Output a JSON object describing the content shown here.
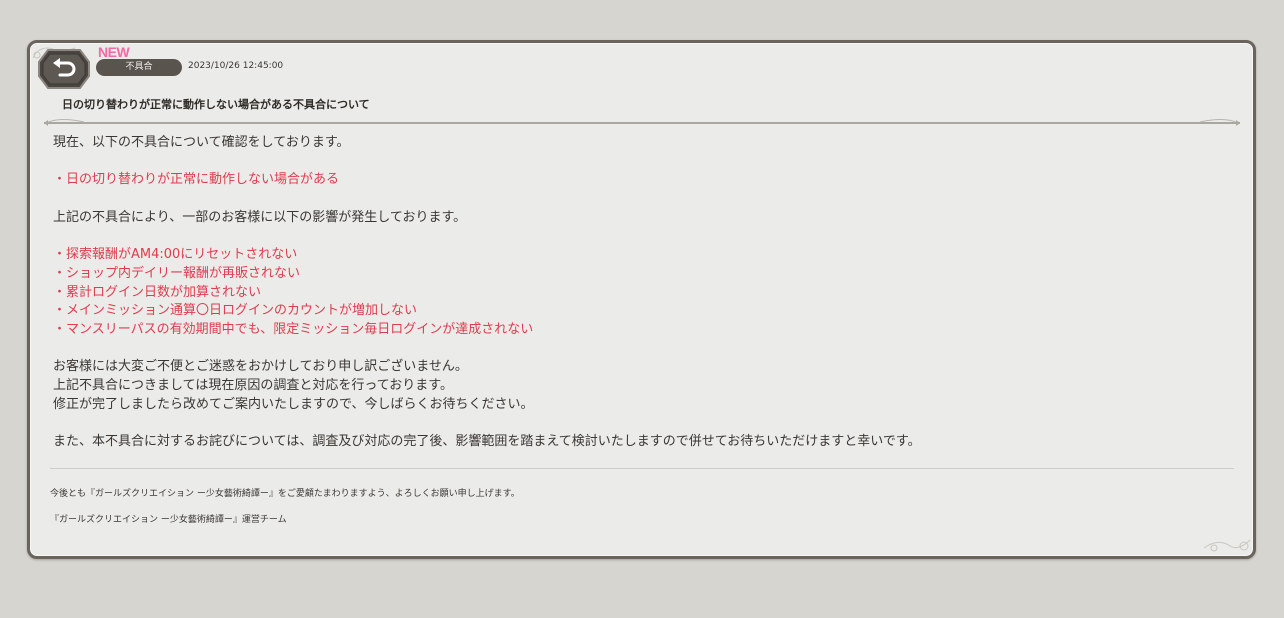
{
  "header": {
    "new_badge": "NEW",
    "category": "不具合",
    "date": "2023/10/26 12:45:00",
    "title": "日の切り替わりが正常に動作しない場合がある不具合について"
  },
  "body": {
    "intro": "現在、以下の不具合について確認をしております。",
    "issue": "・日の切り替わりが正常に動作しない場合がある",
    "impact_intro": "上記の不具合により、一部のお客様に以下の影響が発生しております。",
    "impacts": [
      "・探索報酬がAM4:00にリセットされない",
      "・ショップ内デイリー報酬が再販されない",
      "・累計ログイン日数が加算されない",
      "・メインミッション通算〇日ログインのカウントが増加しない",
      "・マンスリーパスの有効期間中でも、限定ミッション毎日ログインが達成されない"
    ],
    "apology": [
      "お客様には大変ご不便とご迷惑をおかけしており申し訳ございません。",
      "上記不具合につきましては現在原因の調査と対応を行っております。",
      "修正が完了しましたら改めてご案内いたしますので、今しばらくお待ちください。"
    ],
    "compensation": "また、本不具合に対するお詫びについては、調査及び対応の完了後、影響範囲を踏まえて検討いたしますので併せてお待ちいただけますと幸いです。"
  },
  "footer": {
    "closing": "今後とも『ガールズクリエイション ー少女藝術綺譚ー』をご愛顧たまわりますよう、よろしくお願い申し上げます。",
    "signature": "『ガールズクリエイション ー少女藝術綺譚ー』運営チーム"
  },
  "icons": {
    "back": "back-arrow-icon"
  },
  "colors": {
    "accent_red": "#e03c4f",
    "new_pink": "#f06aa5",
    "pill": "#5a544e",
    "panel_border": "#6b645c",
    "background": "#d7d5cf"
  }
}
